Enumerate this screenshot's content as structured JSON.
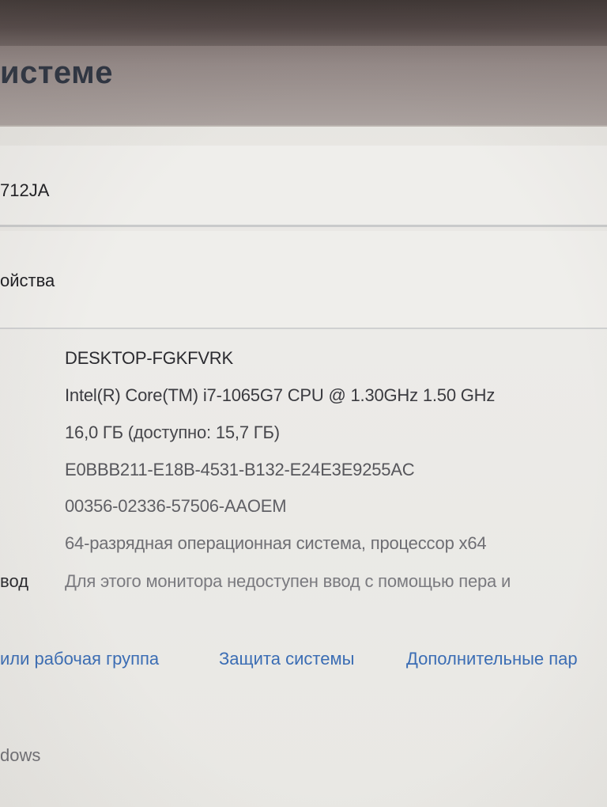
{
  "header": {
    "title": "истеме"
  },
  "device": {
    "model_fragment": "712JA"
  },
  "specs_section": {
    "heading_fragment": "ойства"
  },
  "specs": [
    {
      "label": "",
      "value": "DESKTOP-FGKFVRK",
      "color": "#2b2b30"
    },
    {
      "label": "",
      "value": "Intel(R) Core(TM) i7-1065G7 CPU @ 1.30GHz   1.50 GHz",
      "color": "#3b3b40"
    },
    {
      "label": "",
      "value": "16,0 ГБ (доступно: 15,7 ГБ)",
      "color": "#46464b"
    },
    {
      "label": "",
      "value": "E0BBB211-E18B-4531-B132-E24E3E9255AC",
      "color": "#56565b"
    },
    {
      "label": "",
      "value": "00356-02336-57506-AAOEM",
      "color": "#606065"
    },
    {
      "label": "",
      "value": "64-разрядная операционная система, процессор x64",
      "color": "#6e6e73"
    },
    {
      "label": "вод",
      "value": "Для этого монитора недоступен ввод с помощью пера и",
      "color": "#7a7a7f"
    }
  ],
  "links": [
    {
      "label": "или рабочая группа"
    },
    {
      "label": "Защита системы"
    },
    {
      "label": "Дополнительные пар"
    }
  ],
  "footer": {
    "text_fragment": "dows"
  }
}
